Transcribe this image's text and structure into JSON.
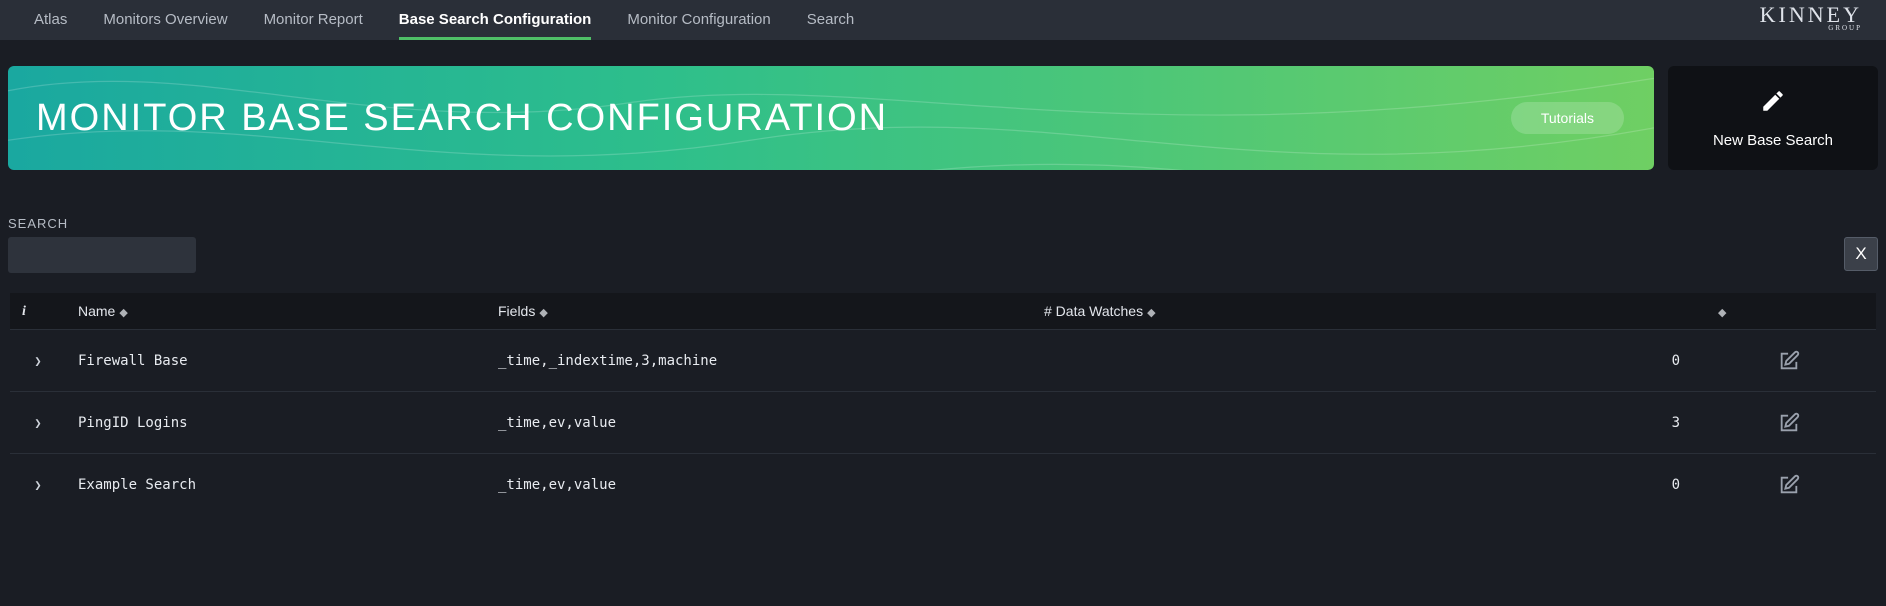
{
  "nav": {
    "items": [
      {
        "label": "Atlas",
        "active": false
      },
      {
        "label": "Monitors Overview",
        "active": false
      },
      {
        "label": "Monitor Report",
        "active": false
      },
      {
        "label": "Base Search Configuration",
        "active": true
      },
      {
        "label": "Monitor Configuration",
        "active": false
      },
      {
        "label": "Search",
        "active": false
      }
    ],
    "logo": "KINNEY",
    "logo_sub": "GROUP"
  },
  "banner": {
    "title": "MONITOR BASE SEARCH CONFIGURATION",
    "tutorials_label": "Tutorials"
  },
  "new_search": {
    "label": "New Base Search"
  },
  "search": {
    "label": "SEARCH",
    "value": "",
    "close_label": "X"
  },
  "table": {
    "headers": {
      "info": "i",
      "name": "Name",
      "fields": "Fields",
      "watches": "# Data Watches"
    },
    "rows": [
      {
        "name": "Firewall Base",
        "fields": "_time,_indextime,3,machine",
        "watches": "0"
      },
      {
        "name": "PingID Logins",
        "fields": "_time,ev,value",
        "watches": "3"
      },
      {
        "name": "Example Search",
        "fields": "_time,ev,value",
        "watches": "0"
      }
    ]
  }
}
